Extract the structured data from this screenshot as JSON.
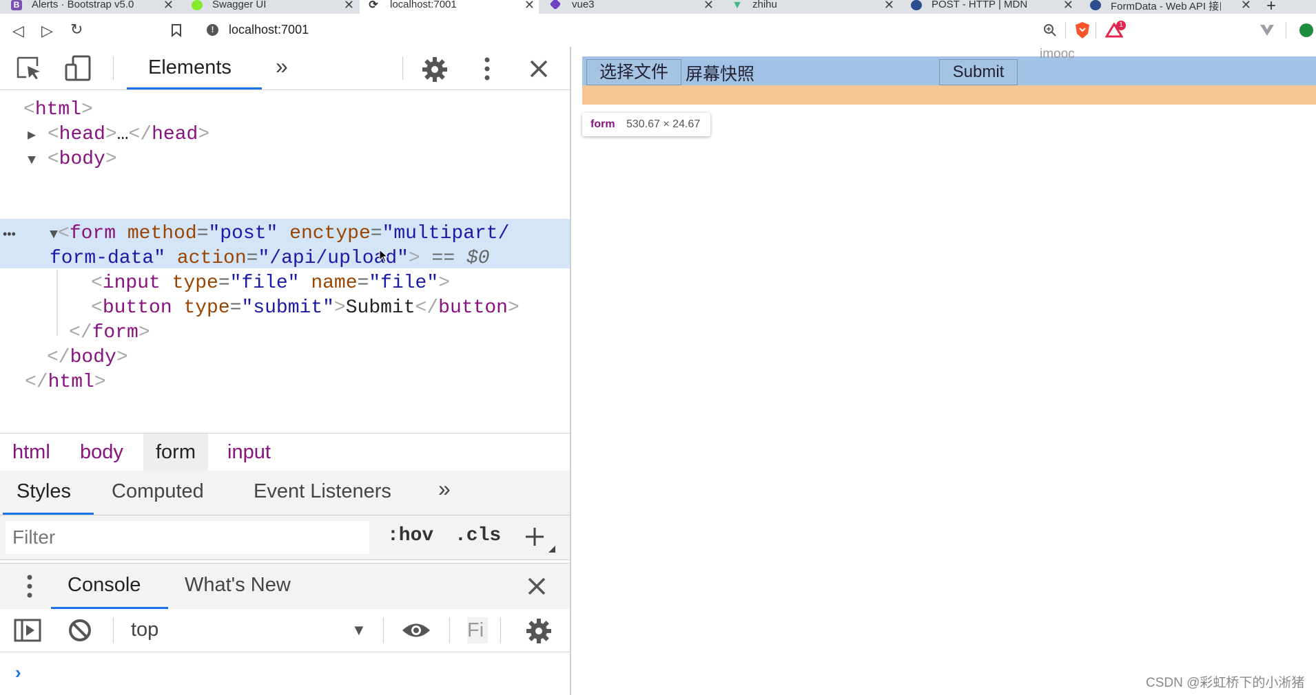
{
  "browser": {
    "tabs": [
      {
        "title": "Alerts · Bootstrap v5.0",
        "fav_letter": "B",
        "fav_color": "#7952b3"
      },
      {
        "title": "Swagger UI",
        "fav_letter": "",
        "fav_color": "#85ea2d"
      },
      {
        "title": "localhost:7001",
        "fav_letter": "",
        "fav_color": "#333333"
      },
      {
        "title": "vue3",
        "fav_letter": "",
        "fav_color": "#6f42c1"
      },
      {
        "title": "zhihu",
        "fav_letter": "",
        "fav_color": "#42b883"
      },
      {
        "title": "POST - HTTP | MDN",
        "fav_letter": "",
        "fav_color": "#2a4d8f"
      },
      {
        "title": "FormData - Web API 接口",
        "fav_letter": "",
        "fav_color": "#2a4d8f"
      }
    ],
    "url": "localhost:7001",
    "lock_symbol": "!",
    "shield_count": "1",
    "icons": [
      "back-icon",
      "forward-icon",
      "reload-icon",
      "bookmark-icon",
      "zoom-icon",
      "brave-shield-icon",
      "rewards-icon",
      "vpn-icon",
      "extension-icon"
    ]
  },
  "devtools": {
    "main_tab": "Elements",
    "dom": {
      "html_open": "<html>",
      "head": "<head>…</head>",
      "body_open": "<body>",
      "form_line1_tag": "<form",
      "form_attr_method": "method",
      "form_val_method": "\"post\"",
      "form_attr_enctype": "enctype",
      "form_val_enctype_1": "\"multipart/",
      "form_val_enctype_2": "form-data\"",
      "form_attr_action": "action",
      "form_val_action": "\"/api/upload\"",
      "form_eq": "== $0",
      "input_tag": "<input",
      "input_attr_type": "type",
      "input_val_type": "\"file\"",
      "input_attr_name": "name",
      "input_val_name": "\"file\"",
      "button_tag": "<button",
      "button_attr_type": "type",
      "button_val_type": "\"submit\"",
      "button_text": "Submit",
      "button_close": "</button>",
      "form_close": "</form>",
      "body_close": "</body>",
      "html_close": "</html>",
      "ellipsis": "•••"
    },
    "breadcrumbs": [
      "html",
      "body",
      "form",
      "input"
    ],
    "style_tabs": [
      "Styles",
      "Computed",
      "Event Listeners"
    ],
    "filter_placeholder": "Filter",
    "hov": ":hov",
    "cls": ".cls",
    "drawer_tabs": [
      "Console",
      "What's New"
    ],
    "console_context": "top",
    "console_filter_stub": "Fi",
    "prompt": "›",
    "accent_color": "#1a73e8"
  },
  "page": {
    "choose_file": "选择文件",
    "no_file": "屏幕快照",
    "submit": "Submit",
    "watermark_text": "imooc",
    "tooltip_tag": "form",
    "tooltip_size": "530.67 × 24.67",
    "form_highlight_color": "#a2c2e6",
    "padding_highlight_color": "#f6c595"
  },
  "footer_watermark": "CSDN @彩虹桥下的小淅猪"
}
